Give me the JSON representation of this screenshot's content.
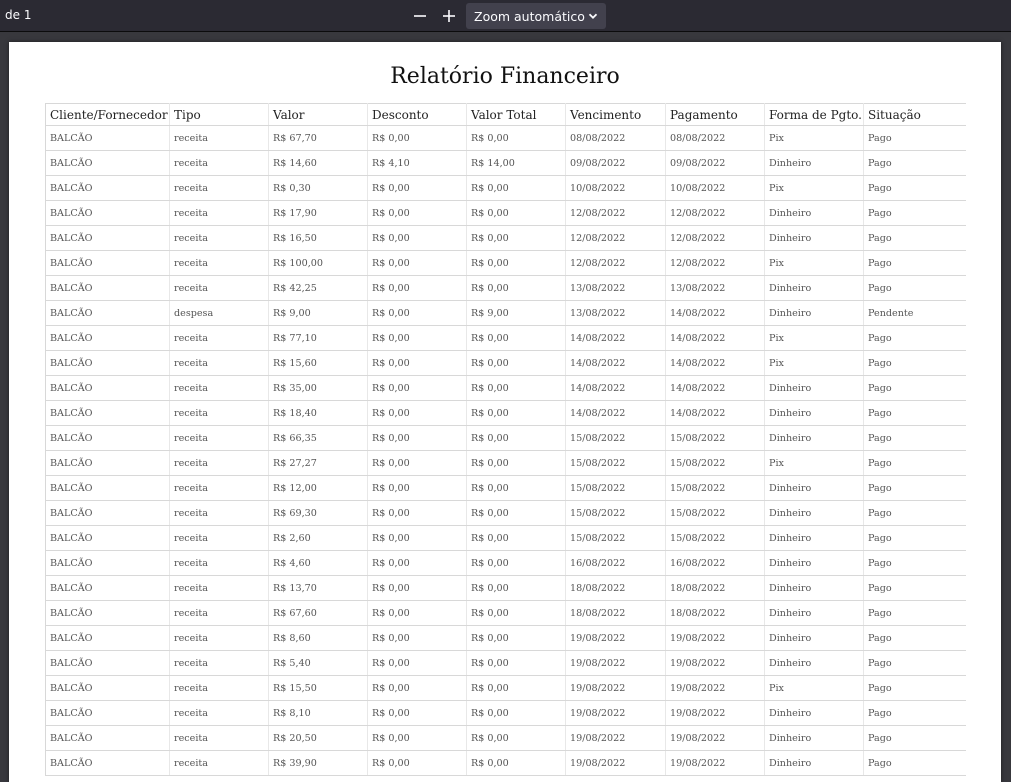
{
  "toolbar": {
    "page_count": "de 1",
    "zoom_out_icon": "minus-icon",
    "zoom_in_icon": "plus-icon",
    "zoom_label": "Zoom automático",
    "zoom_chevron_icon": "chevron-down-icon"
  },
  "report": {
    "title": "Relatório Financeiro",
    "columns": [
      "Cliente/Fornecedor",
      "Tipo",
      "Valor",
      "Desconto",
      "Valor Total",
      "Vencimento",
      "Pagamento",
      "Forma de Pgto.",
      "Situação"
    ],
    "rows": [
      [
        "BALCÃO",
        "receita",
        "R$ 67,70",
        "R$ 0,00",
        "R$ 0,00",
        "08/08/2022",
        "08/08/2022",
        "Pix",
        "Pago"
      ],
      [
        "BALCÃO",
        "receita",
        "R$ 14,60",
        "R$ 4,10",
        "R$ 14,00",
        "09/08/2022",
        "09/08/2022",
        "Dinheiro",
        "Pago"
      ],
      [
        "BALCÃO",
        "receita",
        "R$ 0,30",
        "R$ 0,00",
        "R$ 0,00",
        "10/08/2022",
        "10/08/2022",
        "Pix",
        "Pago"
      ],
      [
        "BALCÃO",
        "receita",
        "R$ 17,90",
        "R$ 0,00",
        "R$ 0,00",
        "12/08/2022",
        "12/08/2022",
        "Dinheiro",
        "Pago"
      ],
      [
        "BALCÃO",
        "receita",
        "R$ 16,50",
        "R$ 0,00",
        "R$ 0,00",
        "12/08/2022",
        "12/08/2022",
        "Dinheiro",
        "Pago"
      ],
      [
        "BALCÃO",
        "receita",
        "R$ 100,00",
        "R$ 0,00",
        "R$ 0,00",
        "12/08/2022",
        "12/08/2022",
        "Pix",
        "Pago"
      ],
      [
        "BALCÃO",
        "receita",
        "R$ 42,25",
        "R$ 0,00",
        "R$ 0,00",
        "13/08/2022",
        "13/08/2022",
        "Dinheiro",
        "Pago"
      ],
      [
        "BALCÃO",
        "despesa",
        "R$ 9,00",
        "R$ 0,00",
        "R$ 9,00",
        "13/08/2022",
        "14/08/2022",
        "Dinheiro",
        "Pendente"
      ],
      [
        "BALCÃO",
        "receita",
        "R$ 77,10",
        "R$ 0,00",
        "R$ 0,00",
        "14/08/2022",
        "14/08/2022",
        "Pix",
        "Pago"
      ],
      [
        "BALCÃO",
        "receita",
        "R$ 15,60",
        "R$ 0,00",
        "R$ 0,00",
        "14/08/2022",
        "14/08/2022",
        "Pix",
        "Pago"
      ],
      [
        "BALCÃO",
        "receita",
        "R$ 35,00",
        "R$ 0,00",
        "R$ 0,00",
        "14/08/2022",
        "14/08/2022",
        "Dinheiro",
        "Pago"
      ],
      [
        "BALCÃO",
        "receita",
        "R$ 18,40",
        "R$ 0,00",
        "R$ 0,00",
        "14/08/2022",
        "14/08/2022",
        "Dinheiro",
        "Pago"
      ],
      [
        "BALCÃO",
        "receita",
        "R$ 66,35",
        "R$ 0,00",
        "R$ 0,00",
        "15/08/2022",
        "15/08/2022",
        "Dinheiro",
        "Pago"
      ],
      [
        "BALCÃO",
        "receita",
        "R$ 27,27",
        "R$ 0,00",
        "R$ 0,00",
        "15/08/2022",
        "15/08/2022",
        "Pix",
        "Pago"
      ],
      [
        "BALCÃO",
        "receita",
        "R$ 12,00",
        "R$ 0,00",
        "R$ 0,00",
        "15/08/2022",
        "15/08/2022",
        "Dinheiro",
        "Pago"
      ],
      [
        "BALCÃO",
        "receita",
        "R$ 69,30",
        "R$ 0,00",
        "R$ 0,00",
        "15/08/2022",
        "15/08/2022",
        "Dinheiro",
        "Pago"
      ],
      [
        "BALCÃO",
        "receita",
        "R$ 2,60",
        "R$ 0,00",
        "R$ 0,00",
        "15/08/2022",
        "15/08/2022",
        "Dinheiro",
        "Pago"
      ],
      [
        "BALCÃO",
        "receita",
        "R$ 4,60",
        "R$ 0,00",
        "R$ 0,00",
        "16/08/2022",
        "16/08/2022",
        "Dinheiro",
        "Pago"
      ],
      [
        "BALCÃO",
        "receita",
        "R$ 13,70",
        "R$ 0,00",
        "R$ 0,00",
        "18/08/2022",
        "18/08/2022",
        "Dinheiro",
        "Pago"
      ],
      [
        "BALCÃO",
        "receita",
        "R$ 67,60",
        "R$ 0,00",
        "R$ 0,00",
        "18/08/2022",
        "18/08/2022",
        "Dinheiro",
        "Pago"
      ],
      [
        "BALCÃO",
        "receita",
        "R$ 8,60",
        "R$ 0,00",
        "R$ 0,00",
        "19/08/2022",
        "19/08/2022",
        "Dinheiro",
        "Pago"
      ],
      [
        "BALCÃO",
        "receita",
        "R$ 5,40",
        "R$ 0,00",
        "R$ 0,00",
        "19/08/2022",
        "19/08/2022",
        "Dinheiro",
        "Pago"
      ],
      [
        "BALCÃO",
        "receita",
        "R$ 15,50",
        "R$ 0,00",
        "R$ 0,00",
        "19/08/2022",
        "19/08/2022",
        "Pix",
        "Pago"
      ],
      [
        "BALCÃO",
        "receita",
        "R$ 8,10",
        "R$ 0,00",
        "R$ 0,00",
        "19/08/2022",
        "19/08/2022",
        "Dinheiro",
        "Pago"
      ],
      [
        "BALCÃO",
        "receita",
        "R$ 20,50",
        "R$ 0,00",
        "R$ 0,00",
        "19/08/2022",
        "19/08/2022",
        "Dinheiro",
        "Pago"
      ],
      [
        "BALCÃO",
        "receita",
        "R$ 39,90",
        "R$ 0,00",
        "R$ 0,00",
        "19/08/2022",
        "19/08/2022",
        "Dinheiro",
        "Pago"
      ]
    ]
  }
}
